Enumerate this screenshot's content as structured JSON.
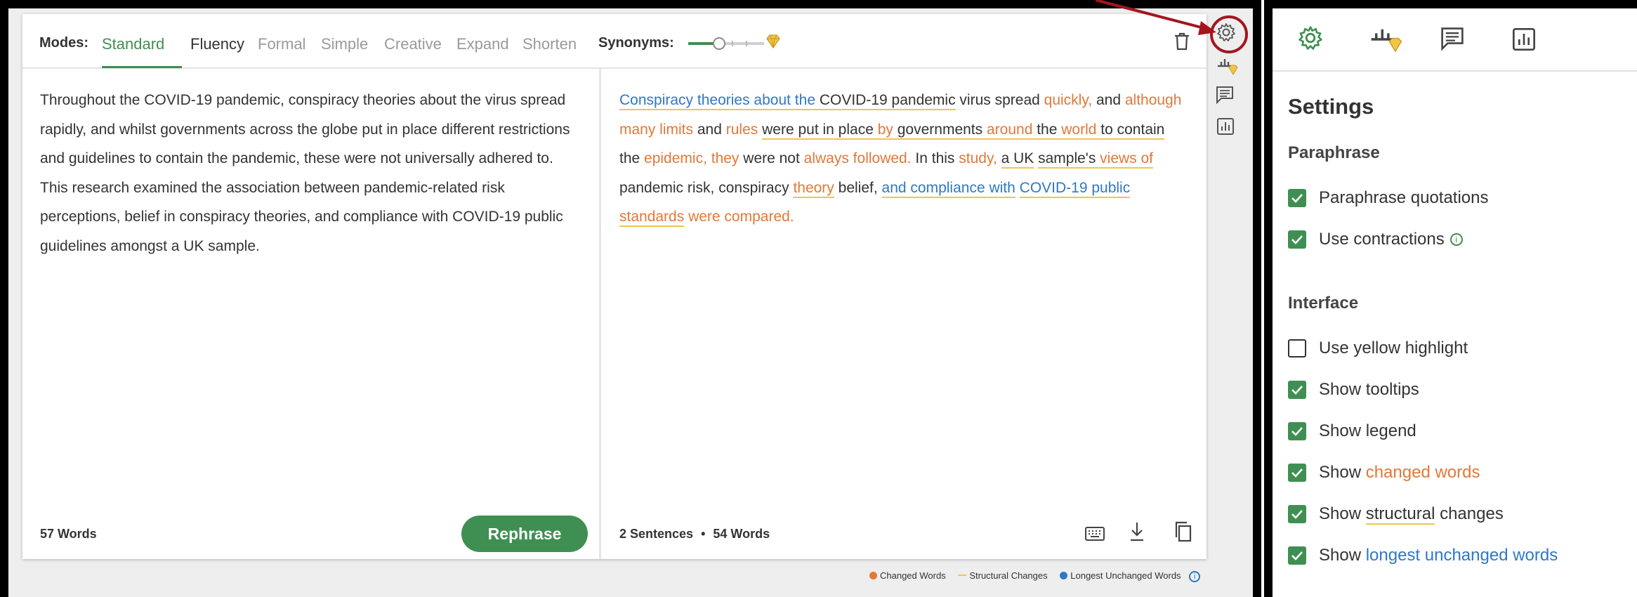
{
  "toolbar": {
    "modes_label": "Modes:",
    "modes": [
      "Standard",
      "Fluency",
      "Formal",
      "Simple",
      "Creative",
      "Expand",
      "Shorten"
    ],
    "active_mode": "Standard",
    "synonyms_label": "Synonyms:",
    "synonyms_level": 0.4
  },
  "input": {
    "text": "Throughout the COVID-19 pandemic, conspiracy theories about the virus spread rapidly, and whilst governments across the globe put in place different restrictions and guidelines to contain the pandemic, these were not universally adhered to. This research examined the association between pandemic-related risk perceptions, belief in conspiracy theories, and compliance with COVID-19 public guidelines amongst a UK sample.",
    "word_count": "57 Words"
  },
  "output": {
    "segments": [
      {
        "t": "Conspiracy theories about the",
        "k": "l",
        "s": true
      },
      {
        "t": " COVID-19 pandemic",
        "k": "",
        "s": true
      },
      {
        "t": " virus spread ",
        "k": ""
      },
      {
        "t": "quickly,",
        "k": "c"
      },
      {
        "t": " and ",
        "k": ""
      },
      {
        "t": "although many limits",
        "k": "c"
      },
      {
        "t": " and ",
        "k": ""
      },
      {
        "t": "rules",
        "k": "c"
      },
      {
        "t": " ",
        "k": ""
      },
      {
        "t": "were put in place ",
        "k": "",
        "s": true
      },
      {
        "t": "by",
        "k": "c",
        "s": true
      },
      {
        "t": " governments ",
        "k": "",
        "s": true
      },
      {
        "t": "around",
        "k": "c",
        "s": true
      },
      {
        "t": " the ",
        "k": "",
        "s": true
      },
      {
        "t": "world",
        "k": "c",
        "s": true
      },
      {
        "t": " to contain",
        "k": "",
        "s": true
      },
      {
        "t": " the ",
        "k": ""
      },
      {
        "t": "epidemic, they",
        "k": "c"
      },
      {
        "t": " were not ",
        "k": ""
      },
      {
        "t": "always followed.",
        "k": "c"
      },
      {
        "t": " In this ",
        "k": ""
      },
      {
        "t": "study,",
        "k": "c"
      },
      {
        "t": " ",
        "k": ""
      },
      {
        "t": "a UK",
        "k": "",
        "s": true
      },
      {
        "t": " ",
        "k": ""
      },
      {
        "t": "sample's ",
        "k": "",
        "s": true
      },
      {
        "t": "views of",
        "k": "c",
        "s": true
      },
      {
        "t": " pandemic risk, conspiracy ",
        "k": ""
      },
      {
        "t": "theory",
        "k": "c",
        "s": true
      },
      {
        "t": " belief, ",
        "k": ""
      },
      {
        "t": "and compliance with",
        "k": "l",
        "s": true
      },
      {
        "t": " ",
        "k": ""
      },
      {
        "t": "COVID-19 public",
        "k": "l",
        "s": true
      },
      {
        "t": " ",
        "k": "",
        "s": true
      },
      {
        "t": "standards",
        "k": "c",
        "s": true
      },
      {
        "t": " were compared.",
        "k": "c"
      }
    ],
    "stats_sentences": "2 Sentences",
    "stats_words": "54 Words"
  },
  "rephrase_label": "Rephrase",
  "legend": {
    "changed": "Changed Words",
    "structural": "Structural Changes",
    "longest": "Longest Unchanged Words"
  },
  "colors": {
    "accent": "#3f8f52",
    "changed": "#e2783a",
    "structural": "#f2c44a",
    "longest": "#2f78c7",
    "highlight_ring": "#a4151f"
  },
  "settings": {
    "title": "Settings",
    "paraphrase_title": "Paraphrase",
    "interface_title": "Interface",
    "paraphrase_options": [
      {
        "label": "Paraphrase quotations",
        "checked": true
      },
      {
        "label": "Use contractions",
        "checked": true,
        "info": true
      }
    ],
    "interface_options": [
      {
        "label": "Use yellow highlight",
        "checked": false
      },
      {
        "label": "Show tooltips",
        "checked": true
      },
      {
        "label": "Show legend",
        "checked": true
      },
      {
        "pre": "Show ",
        "hl": "changed words",
        "kind": "c",
        "post": "",
        "checked": true
      },
      {
        "pre": "Show ",
        "hl": "structural",
        "kind": "s",
        "post": " changes",
        "checked": true
      },
      {
        "pre": "Show ",
        "hl": "longest unchanged words",
        "kind": "l",
        "post": "",
        "checked": true
      }
    ]
  }
}
